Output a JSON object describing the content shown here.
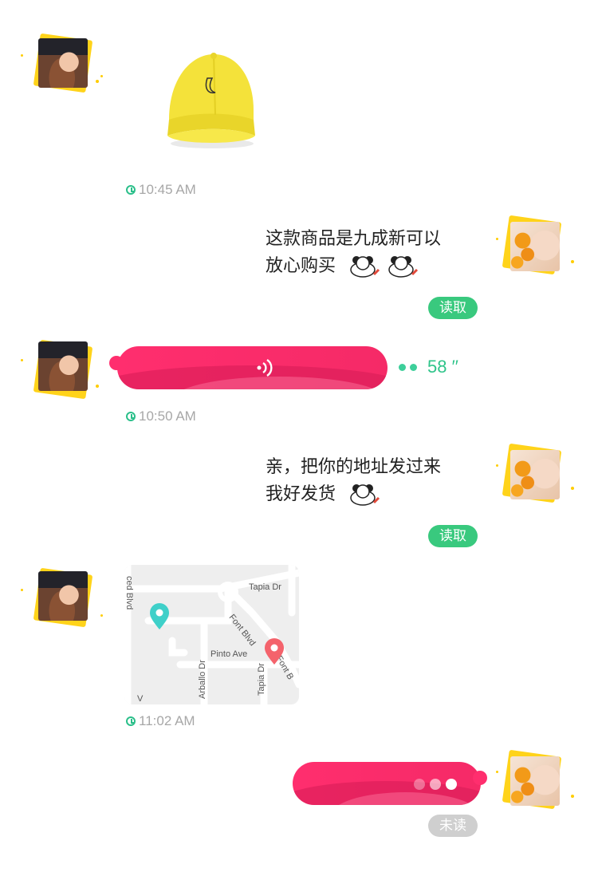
{
  "messages": {
    "m1": {
      "time": "10:45 AM"
    },
    "m2": {
      "line1": "这款商品是九成新可以",
      "line2": "放心购买",
      "status": "读取"
    },
    "m3": {
      "duration": "58 ′′",
      "time": "10:50 AM"
    },
    "m4": {
      "line1": "亲，把你的地址发过来",
      "line2": "我好发货",
      "status": "读取"
    },
    "m5": {
      "time": "11:02 AM",
      "map": {
        "streets": [
          "ced Blvd",
          "Tapia Dr",
          "Font Blvd",
          "Pinto Ave",
          "Arballo Dr",
          "Tapia Dr",
          "Font B",
          "V"
        ]
      }
    },
    "m6": {
      "status": "未读"
    }
  },
  "colors": {
    "accent_green": "#39c97e",
    "voice_pink": "#ff2e6e",
    "unread_gray": "#cfcfcf",
    "avatar_frame": "#ffd31a"
  }
}
